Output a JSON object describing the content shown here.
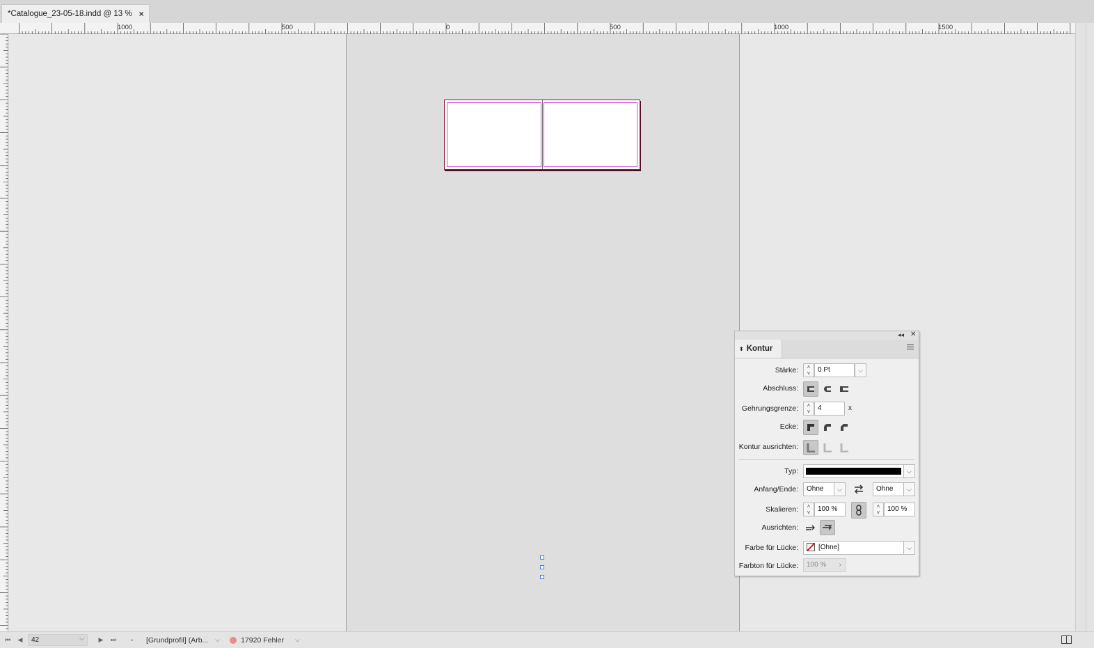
{
  "document": {
    "tab_title": "*Catalogue_23-05-18.indd @ 13 %",
    "close_glyph": "×"
  },
  "ruler": {
    "labels": [
      "1000",
      "500",
      "0",
      "500",
      "1000",
      "1500"
    ]
  },
  "status": {
    "page_number": "42",
    "preflight_profile": "[Grundprofil] (Arb...",
    "errors": "17920 Fehler",
    "error_color": "#ee8a8a"
  },
  "panel": {
    "title": "Kontur",
    "staerke": {
      "label": "Stärke:",
      "value": "0 Pt"
    },
    "abschluss": {
      "label": "Abschluss:"
    },
    "gehrungsgrenze": {
      "label": "Gehrungsgrenze:",
      "value": "4",
      "unit": "x"
    },
    "ecke": {
      "label": "Ecke:"
    },
    "kontur_ausrichten": {
      "label": "Kontur ausrichten:"
    },
    "typ": {
      "label": "Typ:"
    },
    "anfang_ende": {
      "label": "Anfang/Ende:",
      "start": "Ohne",
      "end": "Ohne"
    },
    "skalieren": {
      "label": "Skalieren:",
      "start": "100 %",
      "end": "100 %"
    },
    "ausrichten": {
      "label": "Ausrichten:"
    },
    "farbe_luecke": {
      "label": "Farbe für Lücke:",
      "value": "[Ohne]"
    },
    "farbton_luecke": {
      "label": "Farbton für Lücke:",
      "value": "100 %"
    }
  },
  "colors": {
    "page_margin": "#d24bd6",
    "spread_border": "#8b1a3a",
    "selection": "#3b82f6"
  }
}
